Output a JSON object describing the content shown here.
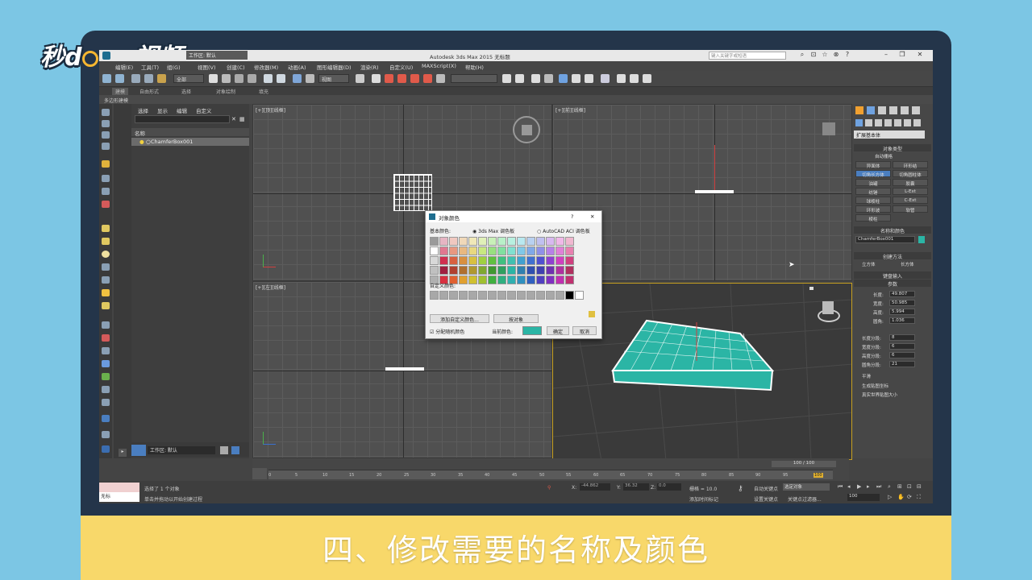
{
  "brand": {
    "logo_left": "秒d",
    "logo_right": "ng视频"
  },
  "caption": "四、修改需要的名称及颜色",
  "window": {
    "title": "Autodesk 3ds Max 2015    无标题",
    "workspace": "工作区: 默认",
    "search_placeholder": "键入关键字或短语"
  },
  "menu": [
    "编辑(E)",
    "工具(T)",
    "组(G)",
    "视图(V)",
    "创建(C)",
    "修改器(M)",
    "动画(A)",
    "图形编辑器(D)",
    "渲染(R)",
    "自定义(U)",
    "MAXScript(X)",
    "帮助(H)"
  ],
  "toolbar": {
    "filter": "全部",
    "view": "视图"
  },
  "ribbon": {
    "tabs": [
      "建模",
      "自由形式",
      "选择",
      "对象绘制",
      "填充"
    ],
    "sub": "多边形建模"
  },
  "explorer": {
    "tabs": [
      "选择",
      "显示",
      "编辑",
      "自定义"
    ],
    "column": "名称",
    "row": "ChamferBox001",
    "workspace_footer": "工作区: 默认"
  },
  "viewports": {
    "top": "[+][顶][线框]",
    "front": "[+][前][线框]",
    "left": "[+][左][线框]"
  },
  "cmd_panel": {
    "category": "扩展基本体",
    "object_type": "对象类型",
    "auto_grid": "自动栅格",
    "buttons": [
      "异面体",
      "环形结",
      "切角长方体",
      "切角圆柱体",
      "油罐",
      "胶囊",
      "纺锤",
      "L-Ext",
      "球棱柱",
      "C-Ext",
      "环形波",
      "软管",
      "棱柱"
    ],
    "name_color": "名称和颜色",
    "object_name": "ChamferBox001",
    "create_method": "创建方法",
    "cube": "立方体",
    "box": "长方体",
    "kb_input": "键盘输入",
    "params": "参数",
    "length_lbl": "长度:",
    "length": "49.807",
    "width_lbl": "宽度:",
    "width": "50.985",
    "height_lbl": "高度:",
    "height": "5.994",
    "fillet_lbl": "圆角:",
    "fillet": "1.036",
    "lseg_lbl": "长度分段:",
    "lseg": "8",
    "wseg_lbl": "宽度分段:",
    "wseg": "6",
    "hseg_lbl": "高度分段:",
    "hseg": "6",
    "fseg_lbl": "圆角分段:",
    "fseg": "21",
    "smooth": "平滑",
    "gen_uv": "生成贴图坐标",
    "real_world": "真实世界贴图大小"
  },
  "dialog": {
    "title": "对象颜色",
    "basic": "基本颜色:",
    "palette1": "3ds Max 调色板",
    "palette2": "AutoCAD ACI 调色板",
    "custom": "自定义颜色:",
    "add_custom": "添加自定义颜色...",
    "by_object": "按对象",
    "random": "分配随机颜色",
    "current": "当前颜色:",
    "ok": "确定",
    "cancel": "取消",
    "current_color": "#2bb5a5"
  },
  "timeline": {
    "counter": "100 / 100",
    "ticks": [
      "0",
      "5",
      "10",
      "15",
      "20",
      "25",
      "30",
      "35",
      "40",
      "45",
      "50",
      "55",
      "60",
      "65",
      "70",
      "75",
      "80",
      "85",
      "90",
      "95",
      "100"
    ]
  },
  "status": {
    "selected": "选择了 1 个对象",
    "hint": "单击并拖动以开始创建过程",
    "x_lbl": "X:",
    "x": "-44.862",
    "y_lbl": "Y:",
    "y": "36.32",
    "z_lbl": "Z:",
    "z": "0.0",
    "grid": "栅格 = 10.0",
    "auto_key": "自动关键点",
    "selected_obj": "选定对象",
    "set_key": "设置关键点",
    "key_filter": "关键点过滤器...",
    "add_time_tag": "添加时间标记",
    "frame": "100",
    "script_label": "无标"
  }
}
